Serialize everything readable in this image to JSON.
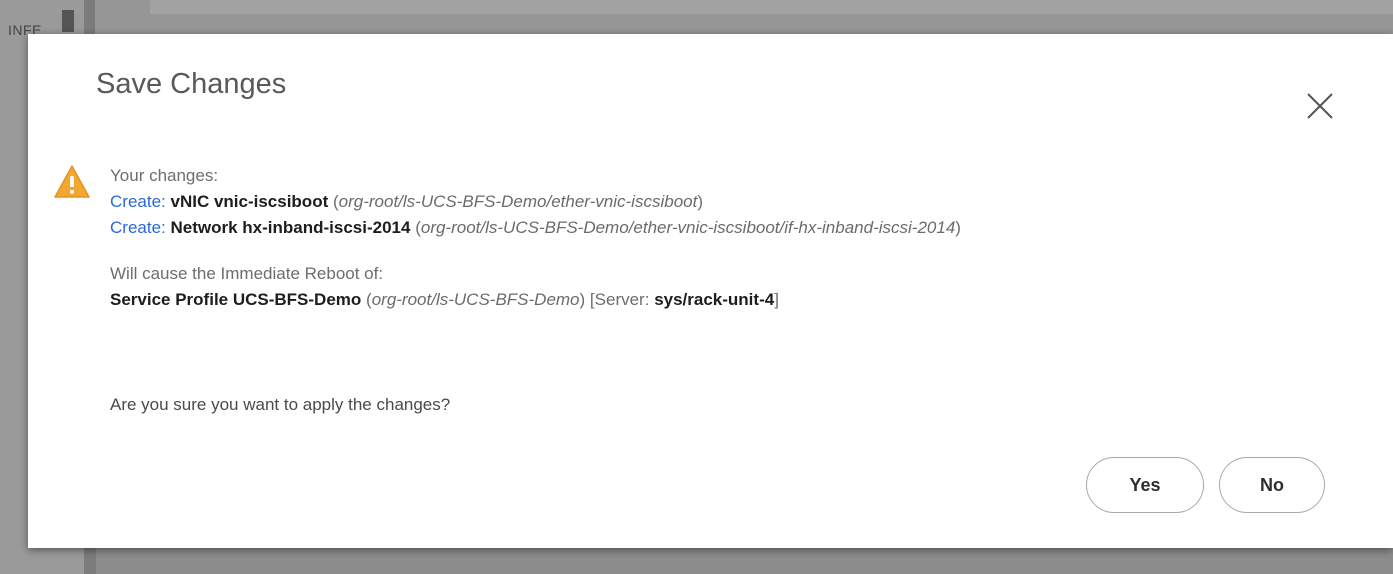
{
  "background": {
    "label": "INFE"
  },
  "dialog": {
    "title": "Save Changes",
    "changes_heading": "Your changes:",
    "changes": [
      {
        "prefix": "Create:",
        "name": "vNIC vnic-iscsiboot",
        "open": "(",
        "path": "org-root/ls-UCS-BFS-Demo/ether-vnic-iscsiboot",
        "close": ")"
      },
      {
        "prefix": "Create:",
        "name": "Network hx-inband-iscsi-2014",
        "open": "(",
        "path": "org-root/ls-UCS-BFS-Demo/ether-vnic-iscsiboot/if-hx-inband-iscsi-2014",
        "close": ")"
      }
    ],
    "reboot": {
      "heading": "Will cause the Immediate Reboot of:",
      "name": "Service Profile UCS-BFS-Demo",
      "open": "(",
      "path": "org-root/ls-UCS-BFS-Demo",
      "close": ")",
      "server_open": "[Server:",
      "server": "sys/rack-unit-4",
      "server_close": "]"
    },
    "question": "Are you sure you want to apply the changes?",
    "buttons": {
      "yes": "Yes",
      "no": "No"
    },
    "icons": {
      "warning": "warning-icon",
      "close": "close-icon"
    },
    "colors": {
      "warning": "#f0a830",
      "prefix": "#2a6ad7"
    }
  }
}
